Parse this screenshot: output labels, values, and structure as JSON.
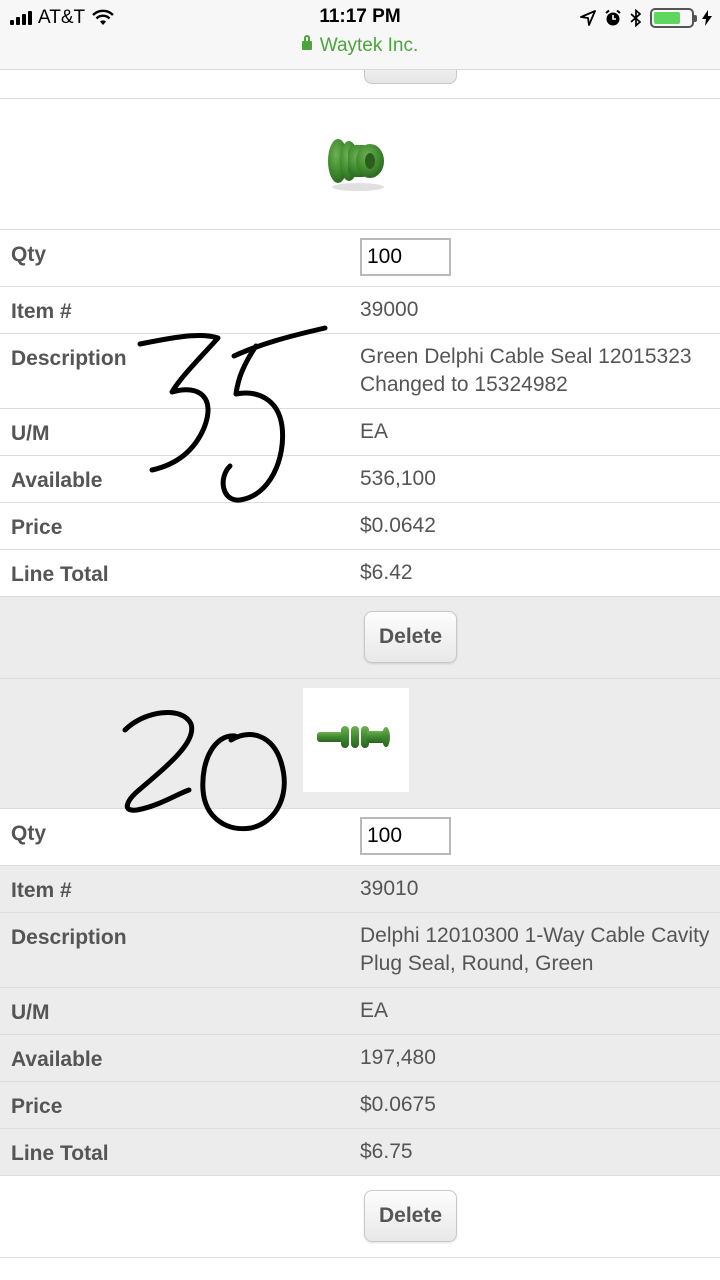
{
  "status_bar": {
    "carrier": "AT&T",
    "time": "11:17 PM",
    "site": "Waytek Inc."
  },
  "items": [
    {
      "qty_label": "Qty",
      "qty_value": "100",
      "item_label": "Item #",
      "item_value": "39000",
      "description_label": "Description",
      "description_value": "Green Delphi Cable Seal 12015323 Changed to 15324982",
      "um_label": "U/M",
      "um_value": "EA",
      "available_label": "Available",
      "available_value": "536,100",
      "price_label": "Price",
      "price_value": "$0.0642",
      "line_total_label": "Line Total",
      "line_total_value": "$6.42",
      "delete_label": "Delete",
      "handwritten_note": "35"
    },
    {
      "qty_label": "Qty",
      "qty_value": "100",
      "item_label": "Item #",
      "item_value": "39010",
      "description_label": "Description",
      "description_value": "Delphi 12010300 1-Way Cable Cavity Plug Seal, Round, Green",
      "um_label": "U/M",
      "um_value": "EA",
      "available_label": "Available",
      "available_value": "197,480",
      "price_label": "Price",
      "price_value": "$0.0675",
      "line_total_label": "Line Total",
      "line_total_value": "$6.75",
      "delete_label": "Delete",
      "handwritten_note": "20"
    }
  ],
  "colors": {
    "secure_green": "#4aa53b",
    "row_alt_gray": "#ececec",
    "product_green": "#3f8a2e"
  }
}
